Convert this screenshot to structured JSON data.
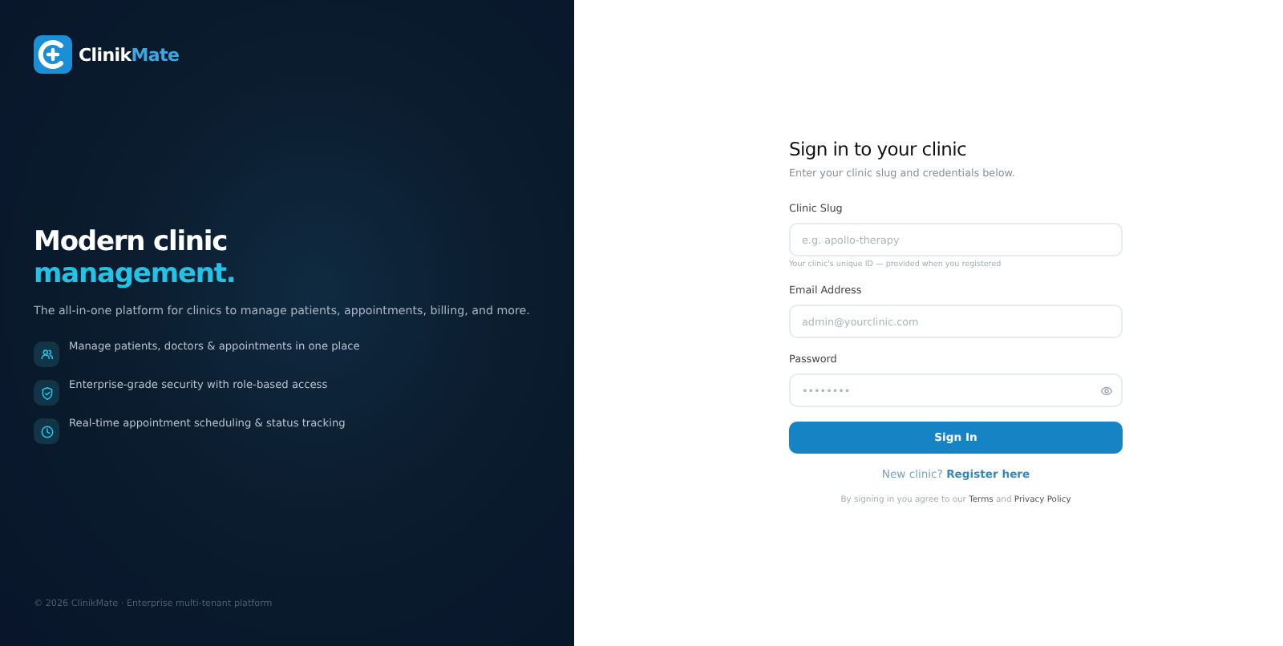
{
  "brand": {
    "name_parts": [
      {
        "text": "Clinik",
        "accent": false
      },
      {
        "text": "Mate",
        "accent": true
      }
    ]
  },
  "hero": {
    "headline": [
      {
        "text": "Modern clinic",
        "accent": false
      },
      {
        "text": "management.",
        "accent": true
      }
    ],
    "tagline": "The all-in-one platform for clinics to manage patients, appointments, billing, and more.",
    "features": [
      {
        "kind": "users",
        "text": "Manage patients, doctors & appointments in one place"
      },
      {
        "kind": "shield",
        "text": "Enterprise-grade security with role-based access"
      },
      {
        "kind": "clock",
        "text": "Real-time appointment scheduling & status tracking"
      }
    ]
  },
  "footer": "© 2026 ClinikMate · Enterprise multi-tenant platform",
  "form": {
    "title": "Sign in to your clinic",
    "subtitle": "Enter your clinic slug and credentials below.",
    "fields": [
      {
        "kind": "text",
        "label": "Clinic Slug",
        "placeholder": "e.g. apollo-therapy",
        "hint": "Your clinic's unique ID — provided when you registered"
      },
      {
        "kind": "email",
        "label": "Email Address",
        "placeholder": "admin@yourclinic.com"
      },
      {
        "kind": "password",
        "label": "Password",
        "placeholder": "••••••••"
      }
    ],
    "submit": "Sign In",
    "register": [
      {
        "kind": "text",
        "text": "New clinic? "
      },
      {
        "kind": "link",
        "text": "Register here"
      }
    ],
    "agreement": [
      {
        "kind": "text",
        "text": "By signing in you agree to our "
      },
      {
        "kind": "link",
        "text": "Terms"
      },
      {
        "kind": "text",
        "text": " and "
      },
      {
        "kind": "link",
        "text": "Privacy Policy"
      }
    ]
  }
}
